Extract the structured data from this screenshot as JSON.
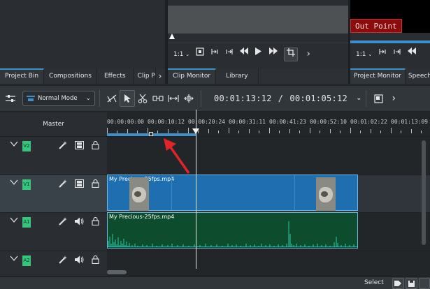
{
  "top": {
    "out_point_label": "Out Point",
    "clip_toolbar": {
      "zoom": "1:1",
      "zoom_chevron": "⌄",
      "overflow": "›"
    },
    "project_toolbar": {
      "zoom": "1:1",
      "zoom_chevron": "⌄"
    }
  },
  "tabs_left": [
    "Project Bin",
    "Compositions",
    "Effects",
    "Clip P"
  ],
  "tabs_left_more": "›",
  "tabs_mid": [
    "Clip Monitor",
    "Library"
  ],
  "tabs_right": [
    "Project Monitor",
    "Speech Ed"
  ],
  "toolbar": {
    "mode": "Normal Mode",
    "timecode_position": "00:01:13:12",
    "timecode_separator": "/",
    "timecode_duration": "00:01:05:12",
    "chevron": "⌄",
    "overflow": "›"
  },
  "timeline": {
    "master_label": "Master",
    "ruler_labels": [
      "00:00:00:00",
      "00:00:10:12",
      "00:00:20:24",
      "00:00:31:11",
      "00:00:41:23",
      "00:00:52:10",
      "00:01:02:22",
      "00:01:13:09"
    ],
    "tracks": [
      {
        "tag": "V2",
        "kind": "video"
      },
      {
        "tag": "V1",
        "kind": "video"
      },
      {
        "tag": "A1",
        "kind": "audio"
      },
      {
        "tag": "A2",
        "kind": "audio"
      }
    ],
    "video_clip_name": "My Precious-25fps.mp4",
    "audio_clip_name": "My Precious-25fps.mp4"
  },
  "status": {
    "select_label": "Select"
  },
  "colors": {
    "accent": "#3d90c9",
    "track_tag": "#37c47c",
    "out_point_bg": "#8c0b0b",
    "video_clip": "#1f6fb0",
    "audio_clip": "#0d4d2e",
    "annotation_arrow": "#e0242a"
  }
}
